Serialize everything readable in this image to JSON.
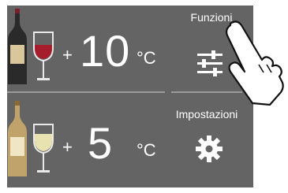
{
  "zones": [
    {
      "name": "red-wine-zone",
      "plus": "+",
      "temperature": "10",
      "unit": "°C"
    },
    {
      "name": "white-wine-zone",
      "plus": "+",
      "temperature": "5",
      "unit": "°C"
    }
  ],
  "menu": {
    "functions_label": "Funzioni",
    "settings_label": "Impostazioni"
  },
  "icons": {
    "functions": "sliders-icon",
    "settings": "gear-icon",
    "red": "red-wine-bottle-glass-icon",
    "white": "white-wine-bottle-glass-icon",
    "hand": "pointing-hand-icon"
  },
  "colors": {
    "panel": "#646464",
    "red_wine": "#a61e2c",
    "white_wine": "#e8e2b0",
    "text": "#ffffff"
  }
}
